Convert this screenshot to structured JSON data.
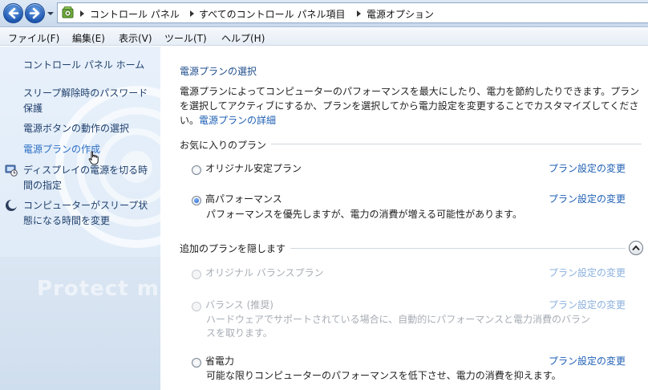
{
  "breadcrumb": {
    "items": [
      "コントロール パネル",
      "すべてのコントロール パネル項目",
      "電源オプション"
    ]
  },
  "menu": {
    "items": [
      "ファイル(F)",
      "編集(E)",
      "表示(V)",
      "ツール(T)",
      "ヘルプ(H)"
    ]
  },
  "sidebar": {
    "home": "コントロール パネル ホーム",
    "links": [
      "スリープ解除時のパスワード",
      "保護",
      "電源ボタンの動作の選択",
      "電源プランの作成",
      "ディスプレイの電源を切る時",
      "間の指定",
      "コンピューターがスリープ状",
      "態になる時間を変更"
    ],
    "watermark": "Protect m"
  },
  "main": {
    "heading": "電源プランの選択",
    "desc_line1": "電源プランによってコンピューターのパフォーマンスを最大にしたり、電力を節約したりできます。プラン",
    "desc_line2": "を選択してアクティブにするか、プランを選択してから電力設定を変更することでカスタマイズしてくださ",
    "desc_line3": "い。",
    "desc_link": "電源プランの詳細",
    "favorites_title": "お気に入りのプラン",
    "hidden_title": "追加のプランを隠します",
    "plan_link_label": "プラン設定の変更",
    "plans": [
      {
        "name": "オリジナル安定プラン",
        "desc": ""
      },
      {
        "name": "高パフォーマンス",
        "desc": "パフォーマンスを優先しますが、電力の消費が増える可能性があります。"
      },
      {
        "name": "オリジナル バランスプラン",
        "desc": ""
      },
      {
        "name": "バランス (推奨)",
        "desc1": "ハードウェアでサポートされている場合に、自動的にパフォーマンスと電力消費のバラン",
        "desc2": "スを取ります。"
      },
      {
        "name": "省電力",
        "desc": "可能な限りコンピューターのパフォーマンスを低下させ、電力の消費を抑えます。"
      }
    ]
  },
  "colors": {
    "link": "#1e5fb4",
    "sidebar_bg": "#e2edf9",
    "accent_radio": "#1a59c7"
  }
}
